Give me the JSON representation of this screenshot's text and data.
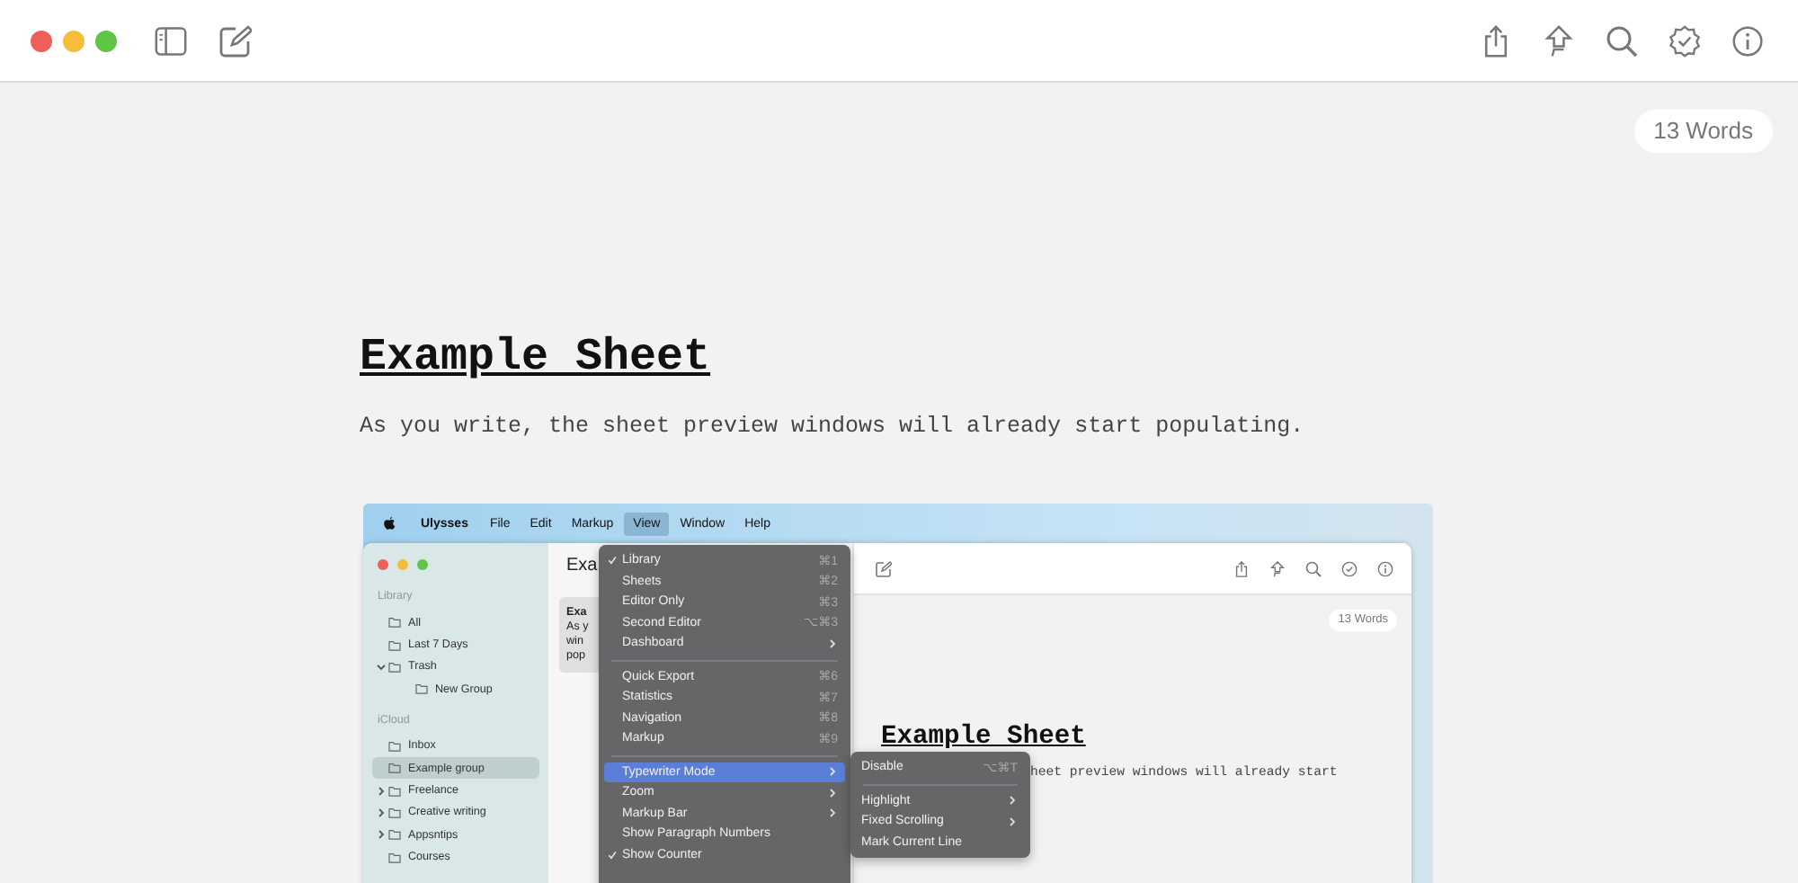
{
  "word_count": "13 Words",
  "document": {
    "title": "Example Sheet",
    "paragraph": "As you write, the sheet preview windows will already start populating."
  },
  "screenshot": {
    "menu_bar": [
      {
        "label": "Ulysses",
        "kind": "app",
        "selected": false
      },
      {
        "label": "File",
        "kind": "menu",
        "selected": false
      },
      {
        "label": "Edit",
        "kind": "menu",
        "selected": false
      },
      {
        "label": "Markup",
        "kind": "menu",
        "selected": false
      },
      {
        "label": "View",
        "kind": "menu",
        "selected": true
      },
      {
        "label": "Window",
        "kind": "menu",
        "selected": false
      },
      {
        "label": "Help",
        "kind": "menu",
        "selected": false
      }
    ],
    "sidebar": [
      {
        "title": "Library",
        "items": [
          {
            "label": "All",
            "expandable": false,
            "selected": false
          },
          {
            "label": "Last 7 Days",
            "expandable": false,
            "selected": false
          },
          {
            "label": "Trash",
            "expandable": true,
            "expanded": true,
            "selected": false,
            "children": [
              {
                "label": "New Group",
                "selected": false
              }
            ]
          }
        ]
      },
      {
        "title": "iCloud",
        "items": [
          {
            "label": "Inbox",
            "expandable": false,
            "selected": false
          },
          {
            "label": "Example group",
            "expandable": false,
            "selected": true
          },
          {
            "label": "Freelance",
            "expandable": true,
            "expanded": false,
            "selected": false
          },
          {
            "label": "Creative writing",
            "expandable": true,
            "expanded": false,
            "selected": false
          },
          {
            "label": "Appsntips",
            "expandable": true,
            "expanded": false,
            "selected": false
          },
          {
            "label": "Courses",
            "expandable": false,
            "selected": false
          }
        ]
      }
    ],
    "sheet_list": {
      "header": "Exa",
      "card": {
        "title": "Exa",
        "lines": [
          "As y",
          "win",
          "pop"
        ]
      }
    },
    "editor": {
      "word_count": "13 Words",
      "title": "Example Sheet",
      "paragraph": "heet preview windows will already start"
    },
    "view_menu": [
      [
        {
          "label": "Library",
          "shortcut": "⌘1",
          "checked": true,
          "submenu": false,
          "selected": false
        },
        {
          "label": "Sheets",
          "shortcut": "⌘2",
          "checked": false,
          "submenu": false,
          "selected": false
        },
        {
          "label": "Editor Only",
          "shortcut": "⌘3",
          "checked": false,
          "submenu": false,
          "selected": false
        },
        {
          "label": "Second Editor",
          "shortcut": "⌥⌘3",
          "checked": false,
          "submenu": false,
          "selected": false
        },
        {
          "label": "Dashboard",
          "checked": false,
          "submenu": true,
          "selected": false
        }
      ],
      [
        {
          "label": "Quick Export",
          "shortcut": "⌘6",
          "checked": false,
          "submenu": false,
          "selected": false
        },
        {
          "label": "Statistics",
          "shortcut": "⌘7",
          "checked": false,
          "submenu": false,
          "selected": false
        },
        {
          "label": "Navigation",
          "shortcut": "⌘8",
          "checked": false,
          "submenu": false,
          "selected": false
        },
        {
          "label": "Markup",
          "shortcut": "⌘9",
          "checked": false,
          "submenu": false,
          "selected": false
        }
      ],
      [
        {
          "label": "Typewriter Mode",
          "checked": false,
          "submenu": true,
          "selected": true
        },
        {
          "label": "Zoom",
          "checked": false,
          "submenu": true,
          "selected": false
        },
        {
          "label": "Markup Bar",
          "checked": false,
          "submenu": true,
          "selected": false
        },
        {
          "label": "Show Paragraph Numbers",
          "checked": false,
          "submenu": false,
          "selected": false
        },
        {
          "label": "Show Counter",
          "checked": true,
          "submenu": false,
          "selected": false
        }
      ]
    ],
    "submenu": [
      [
        {
          "label": "Disable",
          "shortcut": "⌥⌘T",
          "submenu": false
        }
      ],
      [
        {
          "label": "Highlight",
          "submenu": true
        },
        {
          "label": "Fixed Scrolling",
          "submenu": true
        },
        {
          "label": "Mark Current Line",
          "submenu": false
        }
      ]
    ]
  }
}
